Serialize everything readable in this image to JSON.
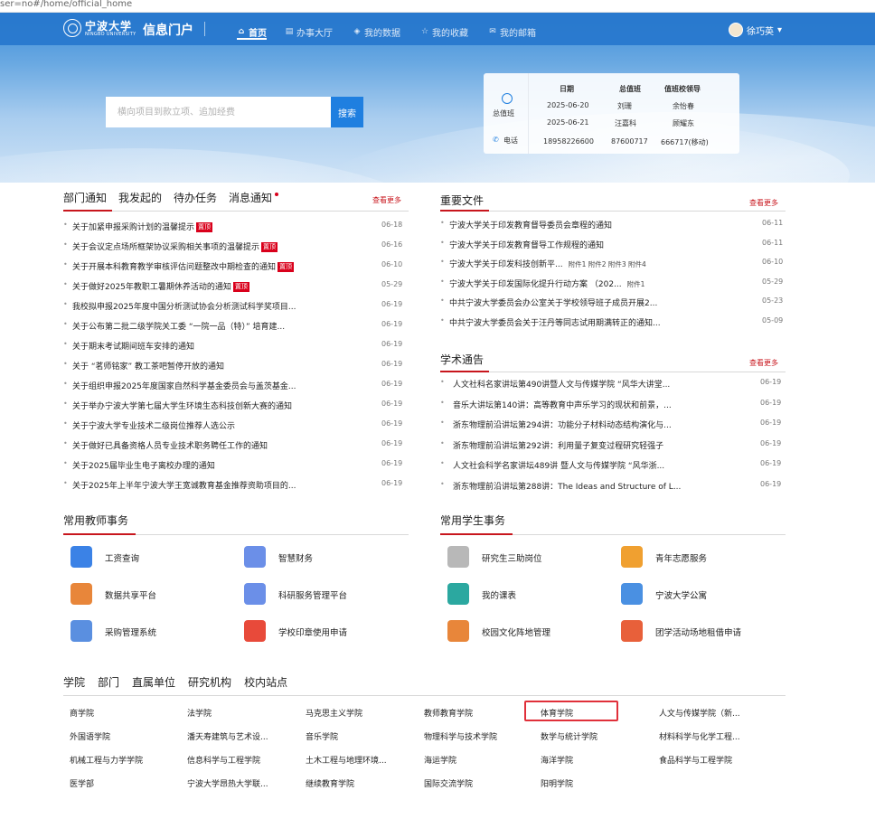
{
  "browser": {
    "url": "ser=no#/home/official_home"
  },
  "header": {
    "logo_cn": "宁波大学",
    "logo_en": "NINGBO UNIVERSITY",
    "portal_title": "信息门户",
    "nav": [
      {
        "label": "首页",
        "icon": "home-icon"
      },
      {
        "label": "办事大厅",
        "icon": "hall-icon"
      },
      {
        "label": "我的数据",
        "icon": "data-icon"
      },
      {
        "label": "我的收藏",
        "icon": "star-icon"
      },
      {
        "label": "我的邮箱",
        "icon": "mail-icon"
      }
    ],
    "user_name": "徐巧英",
    "user_caret": "▾"
  },
  "search": {
    "placeholder": "横向项目到款立项、追加经费",
    "button": "搜索"
  },
  "duty": {
    "office_label": "总值班",
    "phone_label": "电话",
    "headers": [
      "日期",
      "总值班",
      "值班校领导"
    ],
    "rows": [
      [
        "2025-06-20",
        "刘珊",
        "余怡春"
      ],
      [
        "2025-06-21",
        "汪嘉科",
        "顾耀东"
      ]
    ],
    "phones": [
      "18958226600",
      "87600717",
      "666717(移动)"
    ]
  },
  "notice": {
    "tabs": [
      "部门通知",
      "我发起的",
      "待办任务",
      "消息通知"
    ],
    "more": "查看更多",
    "items": [
      {
        "title": "关于加紧申报采购计划的温馨提示",
        "badge": "置顶",
        "date": "06-18"
      },
      {
        "title": "关于会议定点场所框架协议采购相关事项的温馨提示",
        "badge": "置顶",
        "date": "06-16"
      },
      {
        "title": "关于开展本科教育教学审核评估问题整改中期检查的通知",
        "badge": "置顶",
        "date": "06-10"
      },
      {
        "title": "关于做好2025年教职工暑期休养活动的通知",
        "badge": "置顶",
        "date": "05-29"
      },
      {
        "title": "我校拟申报2025年度中国分析测试协会分析测试科学奖项目...",
        "badge": "",
        "date": "06-19"
      },
      {
        "title": "关于公布第二批二级学院关工委 “一院一品（特）” 培育建...",
        "badge": "",
        "date": "06-19"
      },
      {
        "title": "关于期末考试期间班车安排的通知",
        "badge": "",
        "date": "06-19"
      },
      {
        "title": "关于 “茗师铭家” 教工茶吧暂停开放的通知",
        "badge": "",
        "date": "06-19"
      },
      {
        "title": "关于组织申报2025年度国家自然科学基金委员会与盖茨基金...",
        "badge": "",
        "date": "06-19"
      },
      {
        "title": "关于举办宁波大学第七届大学生环境生态科技创新大赛的通知",
        "badge": "",
        "date": "06-19"
      },
      {
        "title": "关于宁波大学专业技术二级岗位推荐人选公示",
        "badge": "",
        "date": "06-19"
      },
      {
        "title": "关于做好已具备资格人员专业技术职务聘任工作的通知",
        "badge": "",
        "date": "06-19"
      },
      {
        "title": "关于2025届毕业生电子离校办理的通知",
        "badge": "",
        "date": "06-19"
      },
      {
        "title": "关于2025年上半年宁波大学王宽诚教育基金推荐资助项目的...",
        "badge": "",
        "date": "06-19"
      }
    ]
  },
  "important": {
    "title": "重要文件",
    "more": "查看更多",
    "items": [
      {
        "title": "宁波大学关于印发教育督导委员会章程的通知",
        "att": "",
        "date": "06-11"
      },
      {
        "title": "宁波大学关于印发教育督导工作规程的通知",
        "att": "",
        "date": "06-11"
      },
      {
        "title": "宁波大学关于印发科技创新平...",
        "att": "附件1 附件2 附件3 附件4",
        "date": "06-10"
      },
      {
        "title": "宁波大学关于印发国际化提升行动方案 （202...",
        "att": "附件1",
        "date": "05-29"
      },
      {
        "title": "中共宁波大学委员会办公室关于学校领导班子成员开展2...",
        "att": "",
        "date": "05-23"
      },
      {
        "title": "中共宁波大学委员会关于汪丹等同志试用期满转正的通知...",
        "att": "",
        "date": "05-09"
      }
    ]
  },
  "academic": {
    "title": "学术通告",
    "more": "查看更多",
    "items": [
      {
        "title": "人文社科名家讲坛第490讲暨人文与传媒学院 “风华大讲堂...",
        "date": "06-19"
      },
      {
        "title": "音乐大讲坛第140讲：高等教育中声乐学习的现状和前景，...",
        "date": "06-19"
      },
      {
        "title": "浙东物理前沿讲坛第294讲：功能分子材料动态结构演化与...",
        "date": "06-19"
      },
      {
        "title": "浙东物理前沿讲坛第292讲：利用量子复变过程研究轻强子",
        "date": "06-19"
      },
      {
        "title": "人文社会科学名家讲坛489讲 暨人文与传媒学院 “风华浙...",
        "date": "06-19"
      },
      {
        "title": "浙东物理前沿讲坛第288讲：The Ideas and Structure of L...",
        "date": "06-19"
      }
    ]
  },
  "teacher_services": {
    "title": "常用教师事务",
    "items": [
      {
        "label": "工资查询",
        "icon": "salary-icon",
        "color": "#3b82e6"
      },
      {
        "label": "智慧财务",
        "icon": "finance-icon",
        "color": "#6b8fe8"
      },
      {
        "label": "数据共享平台",
        "icon": "data-share-icon",
        "color": "#e8863a"
      },
      {
        "label": "科研服务管理平台",
        "icon": "research-icon",
        "color": "#6b8fe8"
      },
      {
        "label": "采购管理系统",
        "icon": "purchase-icon",
        "color": "#5a8fe0"
      },
      {
        "label": "学校印章使用申请",
        "icon": "seal-icon",
        "color": "#e84a3a"
      }
    ]
  },
  "student_services": {
    "title": "常用学生事务",
    "items": [
      {
        "label": "研究生三助岗位",
        "icon": "assistant-icon",
        "color": "#b8b8b8"
      },
      {
        "label": "青年志愿服务",
        "icon": "volunteer-icon",
        "color": "#f0a030"
      },
      {
        "label": "我的课表",
        "icon": "schedule-icon",
        "color": "#2ba8a0"
      },
      {
        "label": "宁波大学公寓",
        "icon": "apartment-icon",
        "color": "#4a90e2"
      },
      {
        "label": "校园文化阵地管理",
        "icon": "culture-icon",
        "color": "#e8863a"
      },
      {
        "label": "团学活动场地租借申请",
        "icon": "venue-icon",
        "color": "#e8603a"
      }
    ]
  },
  "colleges": {
    "tabs": [
      "学院",
      "部门",
      "直属单位",
      "研究机构",
      "校内站点"
    ],
    "rows": [
      [
        "商学院",
        "法学院",
        "马克思主义学院",
        "教师教育学院",
        "体育学院",
        "人文与传媒学院（新..."
      ],
      [
        "外国语学院",
        "潘天寿建筑与艺术设...",
        "音乐学院",
        "物理科学与技术学院",
        "数学与统计学院",
        "材料科学与化学工程..."
      ],
      [
        "机械工程与力学学院",
        "信息科学与工程学院",
        "土木工程与地理环境...",
        "海运学院",
        "海洋学院",
        "食品科学与工程学院"
      ],
      [
        "医学部",
        "宁波大学昂热大学联...",
        "继续教育学院",
        "国际交流学院",
        "阳明学院",
        ""
      ]
    ]
  }
}
